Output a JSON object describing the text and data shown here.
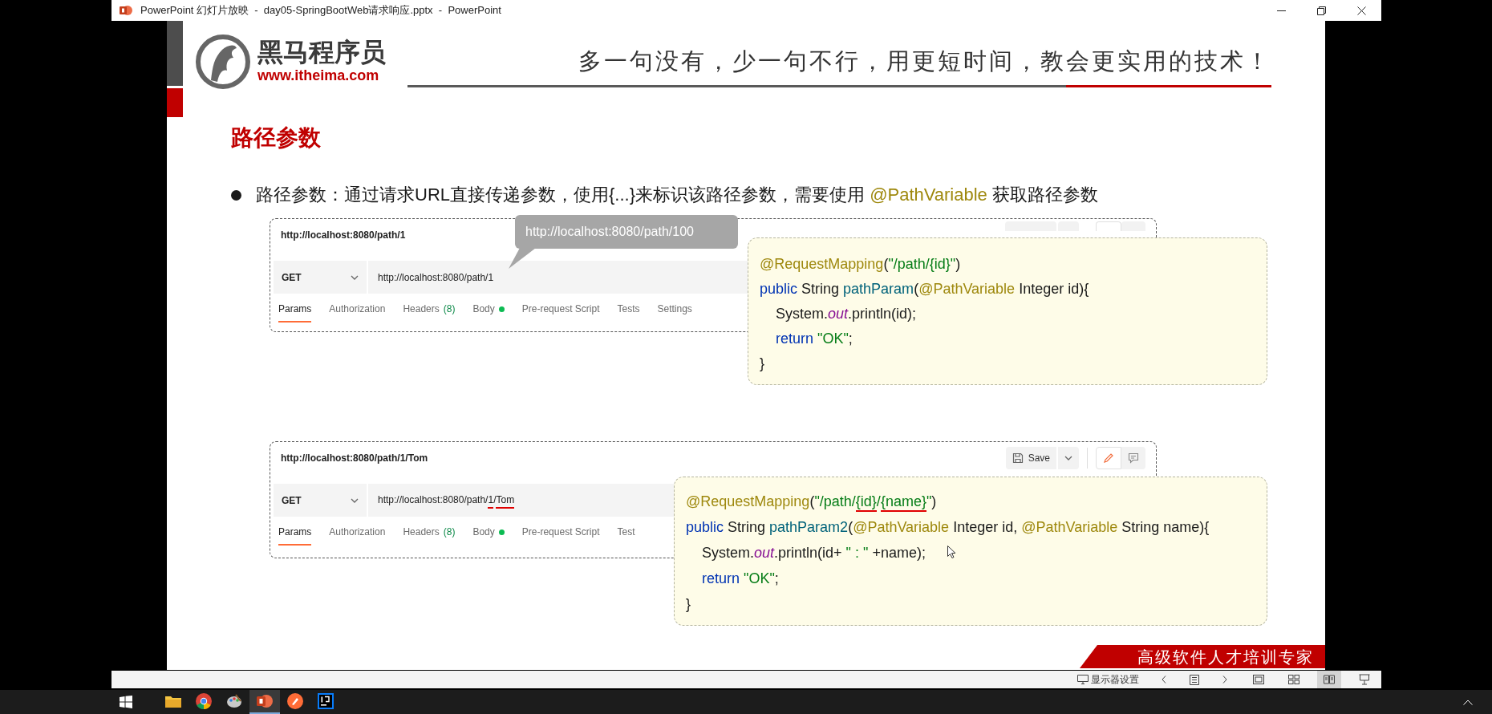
{
  "window": {
    "title": "PowerPoint 幻灯片放映  -  day05-SpringBootWeb请求响应.pptx  -  PowerPoint"
  },
  "slide": {
    "logo": {
      "name": "黑马程序员",
      "url": "www.itheima.com"
    },
    "slogan": "多一句没有，少一句不行，用更短时间，教会更实用的技术！",
    "title": "路径参数",
    "bullet": [
      {
        "text": "路径参数：通过请求URL直接传递参数，使用{...}来标识该路径参数，需要使用 ",
        "kind": "plain"
      },
      {
        "text": "@PathVariable",
        "kind": "annotation"
      },
      {
        "text": " 获取路径参数",
        "kind": "plain"
      }
    ],
    "examples": [
      {
        "request_title": "http://localhost:8080/path/1",
        "toolbar_covered": true,
        "method": "GET",
        "url": [
          {
            "text": "http://localhost:8080/path/1"
          }
        ],
        "tabs": [
          {
            "label": "Params",
            "selected": true,
            "dot": false
          },
          {
            "label": "Authorization",
            "selected": false,
            "dot": false
          },
          {
            "label": "Headers",
            "count": "(8)",
            "selected": false,
            "dot": false
          },
          {
            "label": "Body",
            "selected": false,
            "dot": true
          },
          {
            "label": "Pre-request Script",
            "selected": false,
            "dot": false
          },
          {
            "label": "Tests",
            "selected": false,
            "dot": false
          },
          {
            "label": "Settings",
            "selected": false,
            "dot": false
          }
        ],
        "tooltip": "http://localhost:8080/path/100",
        "code": [
          {
            "indented": false,
            "tokens": [
              {
                "text": "@RequestMapping",
                "kind": "annotation"
              },
              {
                "text": "(",
                "kind": "plain"
              },
              {
                "text": "\"/path/{id}\"",
                "kind": "string"
              },
              {
                "text": ")",
                "kind": "plain"
              }
            ]
          },
          {
            "indented": false,
            "tokens": [
              {
                "text": "public",
                "kind": "keyword"
              },
              {
                "text": " String ",
                "kind": "plain"
              },
              {
                "text": "pathParam",
                "kind": "method"
              },
              {
                "text": "(",
                "kind": "plain"
              },
              {
                "text": "@PathVariable",
                "kind": "annotation"
              },
              {
                "text": " Integer id){",
                "kind": "plain"
              }
            ]
          },
          {
            "indented": true,
            "tokens": [
              {
                "text": "System.",
                "kind": "plain"
              },
              {
                "text": "out",
                "kind": "field"
              },
              {
                "text": ".println(id);",
                "kind": "plain"
              }
            ]
          },
          {
            "indented": true,
            "tokens": [
              {
                "text": "return ",
                "kind": "keyword"
              },
              {
                "text": "\"OK\"",
                "kind": "string"
              },
              {
                "text": ";",
                "kind": "plain"
              }
            ]
          },
          {
            "indented": false,
            "tokens": [
              {
                "text": "}",
                "kind": "plain"
              }
            ]
          }
        ]
      },
      {
        "request_title": "http://localhost:8080/path/1/Tom",
        "toolbar_covered": false,
        "save": "Save",
        "method": "GET",
        "url": [
          {
            "text": "http://localhost:8080/path/"
          },
          {
            "text": "1",
            "underlined": true
          },
          {
            "text": "/"
          },
          {
            "text": "Tom",
            "underlined": true
          }
        ],
        "tabs": [
          {
            "label": "Params",
            "selected": true,
            "dot": false
          },
          {
            "label": "Authorization",
            "selected": false,
            "dot": false
          },
          {
            "label": "Headers",
            "count": "(8)",
            "selected": false,
            "dot": false
          },
          {
            "label": "Body",
            "selected": false,
            "dot": true
          },
          {
            "label": "Pre-request Script",
            "selected": false,
            "dot": false
          },
          {
            "label": "Test",
            "selected": false,
            "dot": false
          }
        ],
        "code": [
          {
            "indented": false,
            "tokens": [
              {
                "text": "@RequestMapping",
                "kind": "annotation"
              },
              {
                "text": "(",
                "kind": "plain"
              },
              {
                "text": "\"/path/",
                "kind": "string"
              },
              {
                "text": "{id}",
                "kind": "string",
                "underlined": true
              },
              {
                "text": "/",
                "kind": "string"
              },
              {
                "text": "{name}",
                "kind": "string",
                "underlined": true
              },
              {
                "text": "\"",
                "kind": "string"
              },
              {
                "text": ")",
                "kind": "plain"
              }
            ]
          },
          {
            "indented": false,
            "tokens": [
              {
                "text": "public",
                "kind": "keyword"
              },
              {
                "text": " String ",
                "kind": "plain"
              },
              {
                "text": "pathParam2",
                "kind": "method"
              },
              {
                "text": "(",
                "kind": "plain"
              },
              {
                "text": "@PathVariable",
                "kind": "annotation"
              },
              {
                "text": " Integer id, ",
                "kind": "plain"
              },
              {
                "text": "@PathVariable",
                "kind": "annotation"
              },
              {
                "text": " String name){",
                "kind": "plain"
              }
            ]
          },
          {
            "indented": true,
            "tokens": [
              {
                "text": "System.",
                "kind": "plain"
              },
              {
                "text": "out",
                "kind": "field"
              },
              {
                "text": ".println(id+ ",
                "kind": "plain"
              },
              {
                "text": "\" : \"",
                "kind": "string"
              },
              {
                "text": " +name);",
                "kind": "plain"
              }
            ]
          },
          {
            "indented": true,
            "tokens": [
              {
                "text": "return ",
                "kind": "keyword"
              },
              {
                "text": "\"OK\"",
                "kind": "string"
              },
              {
                "text": ";",
                "kind": "plain"
              }
            ]
          },
          {
            "indented": false,
            "tokens": [
              {
                "text": "}",
                "kind": "plain"
              }
            ]
          }
        ]
      }
    ],
    "banner": "高级软件人才培训专家"
  },
  "status_bar": {
    "display_settings": "显示器设置",
    "view_buttons": [
      {
        "kind": "normal",
        "selected": false
      },
      {
        "kind": "sorter",
        "selected": false
      },
      {
        "kind": "reading",
        "selected": true
      },
      {
        "kind": "slideshow",
        "selected": false
      }
    ]
  },
  "taskbar": {
    "apps": [
      {
        "kind": "folder",
        "selected": false
      },
      {
        "kind": "browser",
        "selected": false
      },
      {
        "kind": "palette",
        "selected": false
      },
      {
        "kind": "presentation",
        "selected": true
      },
      {
        "kind": "pen-circle",
        "selected": false
      },
      {
        "kind": "ide",
        "selected": false
      }
    ]
  }
}
